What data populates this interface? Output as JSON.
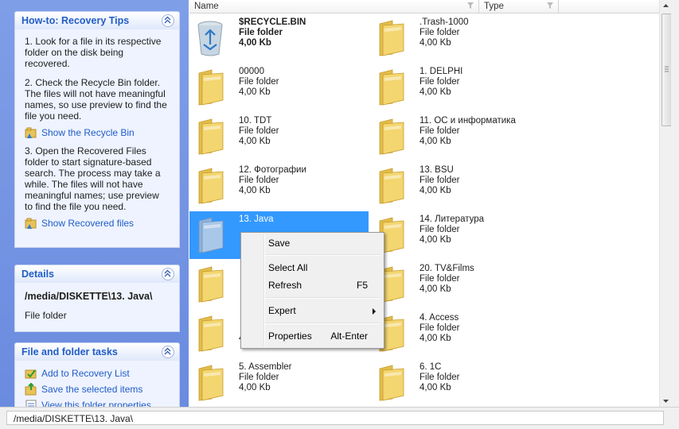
{
  "left_pane": {
    "howto": {
      "title": "How-to: Recovery Tips",
      "tip1": "1. Look for a file in its respective folder on the disk being recovered.",
      "tip2": "2. Check the Recycle Bin folder. The files will not have meaningful names, so use preview to find the file you need.",
      "link1": "Show the Recycle Bin",
      "tip3": "3. Open the Recovered Files folder to start signature-based search. The process may take a while. The files will not have meaningful names; use preview to find the file you need.",
      "link2": "Show Recovered files"
    },
    "details": {
      "title": "Details",
      "path": "/media/DISKETTE\\13. Java\\",
      "type": "File folder"
    },
    "tasks": {
      "title": "File and folder tasks",
      "items": [
        "Add to Recovery List",
        "Save the selected items",
        "View this folder properties"
      ]
    }
  },
  "list": {
    "columns": [
      "Name",
      "Type"
    ],
    "items": [
      {
        "name": "$RECYCLE.BIN",
        "type": "File folder",
        "size": "4,00 Kb",
        "icon": "recycle-bin-icon",
        "bold": true
      },
      {
        "name": ".Trash-1000",
        "type": "File folder",
        "size": "4,00 Kb",
        "icon": "folder-icon"
      },
      {
        "name": "00000",
        "type": "File folder",
        "size": "4,00 Kb",
        "icon": "folder-icon"
      },
      {
        "name": "1. DELPHI",
        "type": "File folder",
        "size": "4,00 Kb",
        "icon": "folder-icon"
      },
      {
        "name": "10. TDT",
        "type": "File folder",
        "size": "4,00 Kb",
        "icon": "folder-icon"
      },
      {
        "name": "11. ОС и информатика",
        "type": "File folder",
        "size": "4,00 Kb",
        "icon": "folder-icon"
      },
      {
        "name": "12. Фотографии",
        "type": "File folder",
        "size": "4,00 Kb",
        "icon": "folder-icon"
      },
      {
        "name": "13. BSU",
        "type": "File folder",
        "size": "4,00 Kb",
        "icon": "folder-icon"
      },
      {
        "name": "13. Java",
        "type": "",
        "size": "",
        "icon": "folder-icon",
        "selected": true
      },
      {
        "name": "14. Литература",
        "type": "File folder",
        "size": "4,00 Kb",
        "icon": "folder-icon"
      },
      {
        "name": "",
        "type": "",
        "size": "",
        "icon": "folder-icon"
      },
      {
        "name": "20. TV&Films",
        "type": "File folder",
        "size": "4,00 Kb",
        "icon": "folder-icon"
      },
      {
        "name": "",
        "type": "",
        "size": "4,00 Kb",
        "icon": "folder-icon"
      },
      {
        "name": "4. Access",
        "type": "File folder",
        "size": "4,00 Kb",
        "icon": "folder-icon"
      },
      {
        "name": "5. Assembler",
        "type": "File folder",
        "size": "4,00 Kb",
        "icon": "folder-icon"
      },
      {
        "name": "6. 1C",
        "type": "File folder",
        "size": "4,00 Kb",
        "icon": "folder-icon"
      }
    ]
  },
  "context_menu": {
    "items": [
      {
        "label": "Save",
        "shortcut": ""
      },
      {
        "label": "Select All",
        "shortcut": ""
      },
      {
        "label": "Refresh",
        "shortcut": "F5"
      },
      {
        "label": "Expert",
        "shortcut": "",
        "submenu": true
      },
      {
        "label": "Properties",
        "shortcut": "Alt-Enter"
      }
    ]
  },
  "status_bar": {
    "path": "/media/DISKETTE\\13. Java\\"
  },
  "colors": {
    "pane_bg": "#6a8bdf",
    "link": "#215dc6",
    "selection": "#3399ff",
    "folder": "#f2d36b"
  }
}
